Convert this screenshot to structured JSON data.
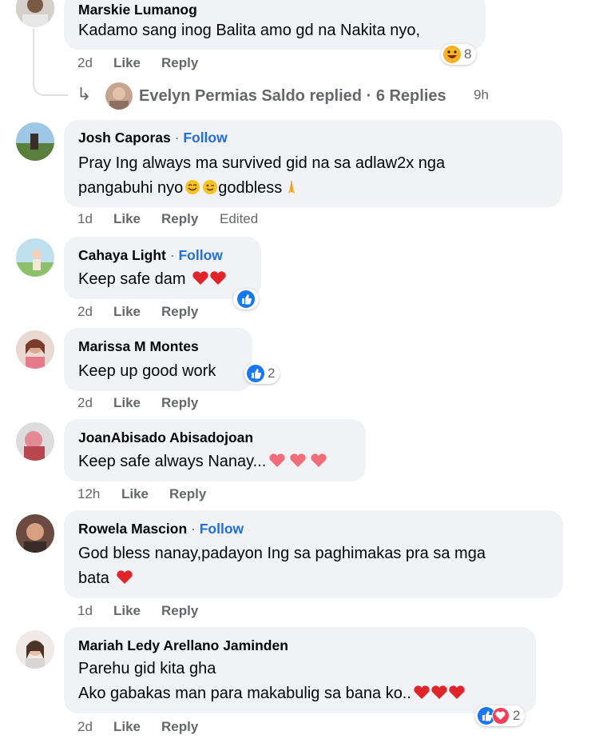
{
  "comments": [
    {
      "author": "Marskie Lumanog",
      "text_lines": [
        "Kadamo sang inog Balita amo gd na Nakita nyo,"
      ],
      "time": "2d",
      "like": "Like",
      "reply": "Reply",
      "reaction_count": "8"
    },
    {
      "author": "Josh Caporas",
      "follow": "Follow",
      "text_lines": [
        "Pray Ing always ma survived gid na sa adlaw2x nga",
        "pangabuhi nyo",
        "godbless"
      ],
      "time": "1d",
      "like": "Like",
      "reply": "Reply",
      "edited": "Edited"
    },
    {
      "author": "Cahaya Light",
      "follow": "Follow",
      "text_lines": [
        "Keep safe dam"
      ],
      "time": "2d",
      "like": "Like",
      "reply": "Reply"
    },
    {
      "author": "Marissa M Montes",
      "text_lines": [
        "Keep up good work"
      ],
      "time": "2d",
      "like": "Like",
      "reply": "Reply",
      "reaction_count": "2"
    },
    {
      "author": "JoanAbisado Abisadojoan",
      "text_lines": [
        "Keep safe always Nanay..."
      ],
      "time": "12h",
      "like": "Like",
      "reply": "Reply"
    },
    {
      "author": "Rowela Mascion",
      "follow": "Follow",
      "text_lines": [
        "God bless nanay,padayon Ing sa paghimakas pra sa mga",
        "bata"
      ],
      "time": "1d",
      "like": "Like",
      "reply": "Reply"
    },
    {
      "author": "Mariah Ledy Arellano Jaminden",
      "text_lines": [
        "Parehu gid kita gha",
        "Ako gabakas man para makabulig sa bana ko.."
      ],
      "time": "2d",
      "like": "Like",
      "reply": "Reply",
      "reaction_count": "2"
    }
  ],
  "replies_thread": {
    "name": "Evelyn Permias Saldo replied",
    "separator": "·",
    "count": "6 Replies",
    "time": "9h"
  },
  "colors": {
    "bubble": "#f0f2f5",
    "follow": "#216fdb",
    "meta": "#65676b",
    "like": "#1877f2",
    "heart": "#f33e58"
  }
}
